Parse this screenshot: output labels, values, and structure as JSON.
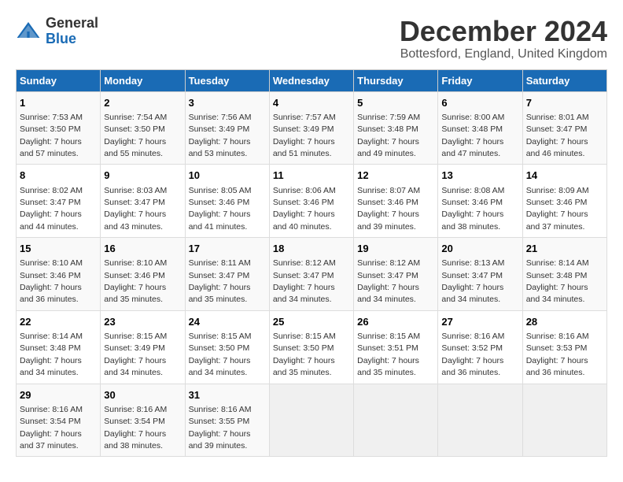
{
  "logo": {
    "general": "General",
    "blue": "Blue"
  },
  "title": "December 2024",
  "subtitle": "Bottesford, England, United Kingdom",
  "days_header": [
    "Sunday",
    "Monday",
    "Tuesday",
    "Wednesday",
    "Thursday",
    "Friday",
    "Saturday"
  ],
  "weeks": [
    [
      {
        "day": "1",
        "sunrise": "7:53 AM",
        "sunset": "3:50 PM",
        "daylight": "7 hours and 57 minutes."
      },
      {
        "day": "2",
        "sunrise": "7:54 AM",
        "sunset": "3:50 PM",
        "daylight": "7 hours and 55 minutes."
      },
      {
        "day": "3",
        "sunrise": "7:56 AM",
        "sunset": "3:49 PM",
        "daylight": "7 hours and 53 minutes."
      },
      {
        "day": "4",
        "sunrise": "7:57 AM",
        "sunset": "3:49 PM",
        "daylight": "7 hours and 51 minutes."
      },
      {
        "day": "5",
        "sunrise": "7:59 AM",
        "sunset": "3:48 PM",
        "daylight": "7 hours and 49 minutes."
      },
      {
        "day": "6",
        "sunrise": "8:00 AM",
        "sunset": "3:48 PM",
        "daylight": "7 hours and 47 minutes."
      },
      {
        "day": "7",
        "sunrise": "8:01 AM",
        "sunset": "3:47 PM",
        "daylight": "7 hours and 46 minutes."
      }
    ],
    [
      {
        "day": "8",
        "sunrise": "8:02 AM",
        "sunset": "3:47 PM",
        "daylight": "7 hours and 44 minutes."
      },
      {
        "day": "9",
        "sunrise": "8:03 AM",
        "sunset": "3:47 PM",
        "daylight": "7 hours and 43 minutes."
      },
      {
        "day": "10",
        "sunrise": "8:05 AM",
        "sunset": "3:46 PM",
        "daylight": "7 hours and 41 minutes."
      },
      {
        "day": "11",
        "sunrise": "8:06 AM",
        "sunset": "3:46 PM",
        "daylight": "7 hours and 40 minutes."
      },
      {
        "day": "12",
        "sunrise": "8:07 AM",
        "sunset": "3:46 PM",
        "daylight": "7 hours and 39 minutes."
      },
      {
        "day": "13",
        "sunrise": "8:08 AM",
        "sunset": "3:46 PM",
        "daylight": "7 hours and 38 minutes."
      },
      {
        "day": "14",
        "sunrise": "8:09 AM",
        "sunset": "3:46 PM",
        "daylight": "7 hours and 37 minutes."
      }
    ],
    [
      {
        "day": "15",
        "sunrise": "8:10 AM",
        "sunset": "3:46 PM",
        "daylight": "7 hours and 36 minutes."
      },
      {
        "day": "16",
        "sunrise": "8:10 AM",
        "sunset": "3:46 PM",
        "daylight": "7 hours and 35 minutes."
      },
      {
        "day": "17",
        "sunrise": "8:11 AM",
        "sunset": "3:47 PM",
        "daylight": "7 hours and 35 minutes."
      },
      {
        "day": "18",
        "sunrise": "8:12 AM",
        "sunset": "3:47 PM",
        "daylight": "7 hours and 34 minutes."
      },
      {
        "day": "19",
        "sunrise": "8:12 AM",
        "sunset": "3:47 PM",
        "daylight": "7 hours and 34 minutes."
      },
      {
        "day": "20",
        "sunrise": "8:13 AM",
        "sunset": "3:47 PM",
        "daylight": "7 hours and 34 minutes."
      },
      {
        "day": "21",
        "sunrise": "8:14 AM",
        "sunset": "3:48 PM",
        "daylight": "7 hours and 34 minutes."
      }
    ],
    [
      {
        "day": "22",
        "sunrise": "8:14 AM",
        "sunset": "3:48 PM",
        "daylight": "7 hours and 34 minutes."
      },
      {
        "day": "23",
        "sunrise": "8:15 AM",
        "sunset": "3:49 PM",
        "daylight": "7 hours and 34 minutes."
      },
      {
        "day": "24",
        "sunrise": "8:15 AM",
        "sunset": "3:50 PM",
        "daylight": "7 hours and 34 minutes."
      },
      {
        "day": "25",
        "sunrise": "8:15 AM",
        "sunset": "3:50 PM",
        "daylight": "7 hours and 35 minutes."
      },
      {
        "day": "26",
        "sunrise": "8:15 AM",
        "sunset": "3:51 PM",
        "daylight": "7 hours and 35 minutes."
      },
      {
        "day": "27",
        "sunrise": "8:16 AM",
        "sunset": "3:52 PM",
        "daylight": "7 hours and 36 minutes."
      },
      {
        "day": "28",
        "sunrise": "8:16 AM",
        "sunset": "3:53 PM",
        "daylight": "7 hours and 36 minutes."
      }
    ],
    [
      {
        "day": "29",
        "sunrise": "8:16 AM",
        "sunset": "3:54 PM",
        "daylight": "7 hours and 37 minutes."
      },
      {
        "day": "30",
        "sunrise": "8:16 AM",
        "sunset": "3:54 PM",
        "daylight": "7 hours and 38 minutes."
      },
      {
        "day": "31",
        "sunrise": "8:16 AM",
        "sunset": "3:55 PM",
        "daylight": "7 hours and 39 minutes."
      },
      null,
      null,
      null,
      null
    ]
  ]
}
